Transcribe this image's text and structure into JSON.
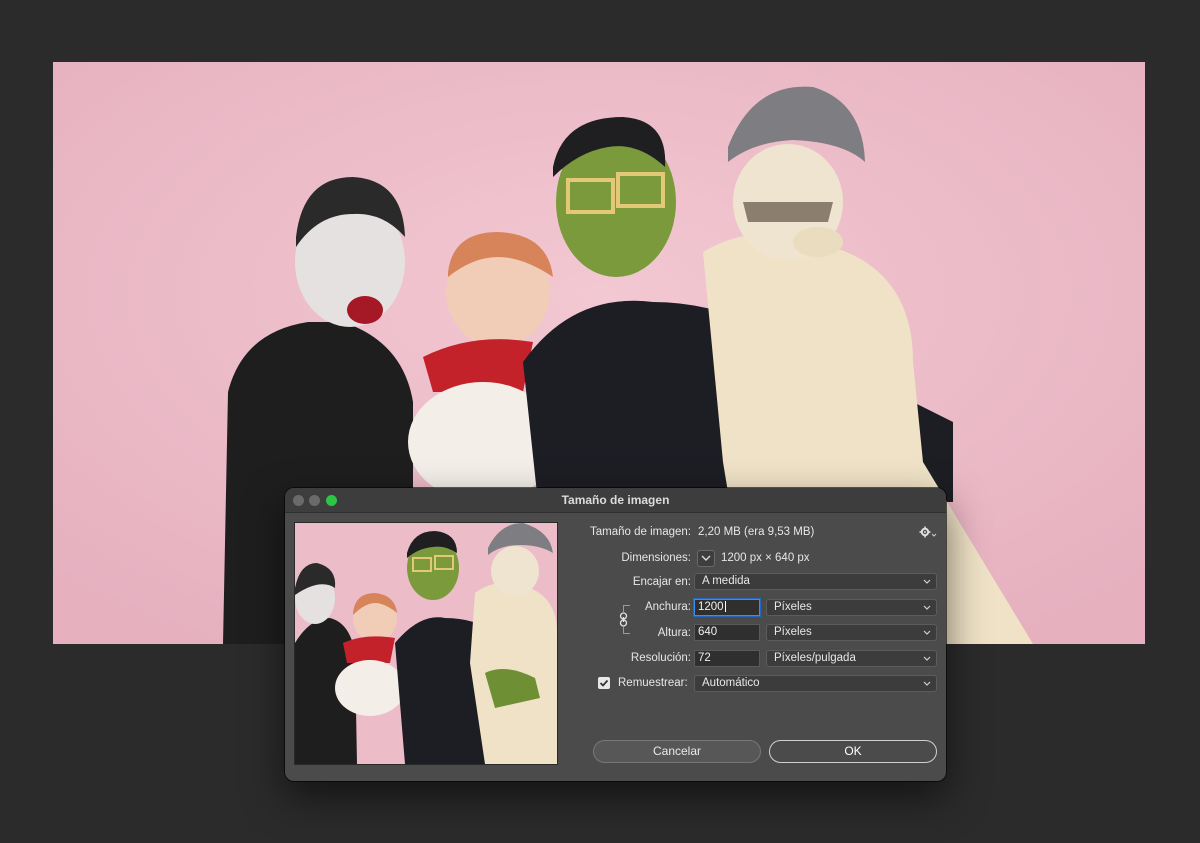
{
  "dialog": {
    "title": "Tamaño de imagen",
    "image_size_label": "Tamaño de imagen:",
    "image_size_value": "2,20 MB (era 9,53 MB)",
    "dimensions_label": "Dimensiones:",
    "dimensions_value": "1200 px × 640 px",
    "fit_label": "Encajar en:",
    "fit_value": "A medida",
    "width_label": "Anchura:",
    "width_value": "1200",
    "width_unit": "Píxeles",
    "height_label": "Altura:",
    "height_value": "640",
    "height_unit": "Píxeles",
    "resolution_label": "Resolución:",
    "resolution_value": "72",
    "resolution_unit": "Píxeles/pulgada",
    "resample_label": "Remuestrear:",
    "resample_checked": true,
    "resample_value": "Automático",
    "cancel_label": "Cancelar",
    "ok_label": "OK"
  },
  "icons": {
    "gear": "gear-icon",
    "chain": "link-icon",
    "chevron": "chevron-down-icon",
    "check": "checkmark-icon"
  },
  "colors": {
    "canvas_bg": "#2b2b2b",
    "photo_bg": "#ecbcc8",
    "dialog_bg": "#4b4b4b",
    "focus": "#3f8cf0",
    "max_button": "#2ec445"
  }
}
